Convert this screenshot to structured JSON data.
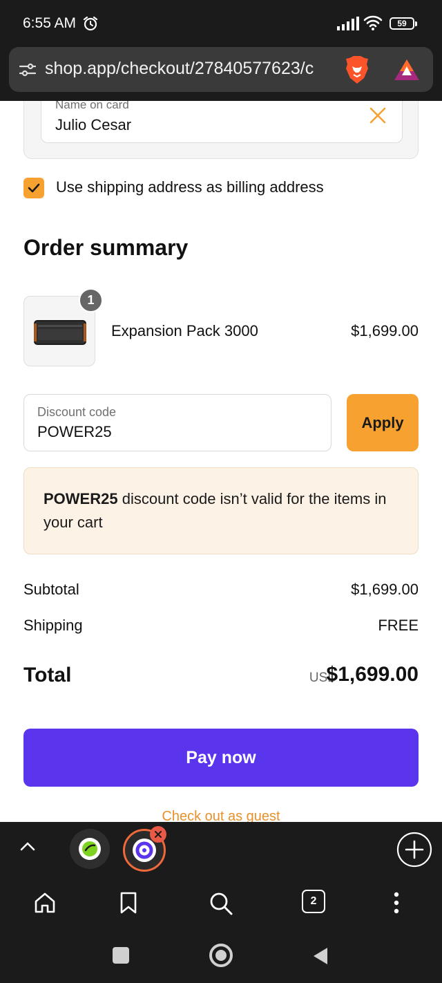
{
  "status_bar": {
    "time": "6:55 AM",
    "battery": "59"
  },
  "browser": {
    "url": "shop.app/checkout/27840577623/c",
    "tab_count": "2"
  },
  "payment": {
    "name_label": "Name on card",
    "name_value": "Julio Cesar",
    "billing_checkbox_label": "Use shipping address as billing address",
    "billing_checked": true
  },
  "order_summary": {
    "title": "Order summary",
    "item": {
      "name": "Expansion Pack 3000",
      "price": "$1,699.00",
      "quantity": "1"
    },
    "discount_label": "Discount code",
    "discount_value": "POWER25",
    "apply_label": "Apply",
    "error_code": "POWER25",
    "error_message": " discount code isn’t valid for the items in your cart",
    "subtotal_label": "Subtotal",
    "subtotal_value": "$1,699.00",
    "shipping_label": "Shipping",
    "shipping_value": "FREE",
    "total_label": "Total",
    "total_currency": "USD",
    "total_value": "$1,699.00",
    "pay_label": "Pay now",
    "guest_label": "Check out as guest"
  },
  "colors": {
    "accent": "#f6a130",
    "pay_button": "#5b34ee",
    "error_bg": "#fdf2e6",
    "guest_link": "#e8912a"
  },
  "icons": [
    "alarm-icon",
    "signal-icon",
    "wifi-icon",
    "tune-icon",
    "brave-lion-icon",
    "rewards-icon",
    "close-icon",
    "check-icon",
    "chevron-up-icon",
    "plus-circle-icon",
    "home-icon",
    "bookmark-icon",
    "search-icon",
    "more-vertical-icon"
  ]
}
